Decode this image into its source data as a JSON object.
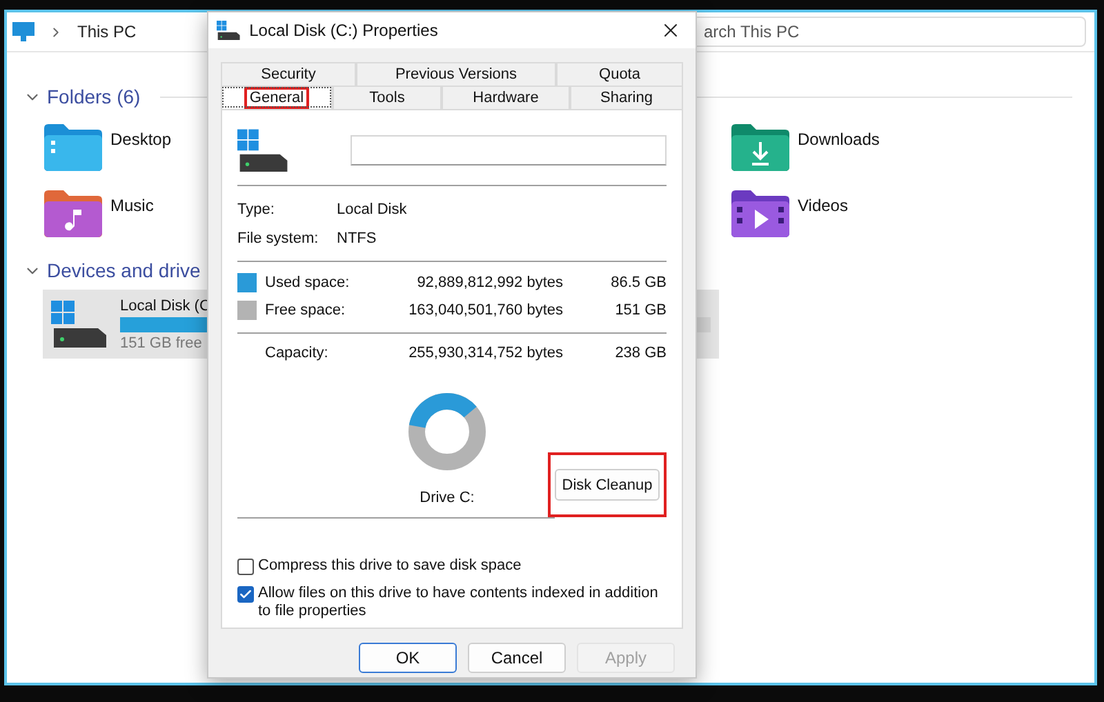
{
  "explorer": {
    "breadcrumb": "This PC",
    "search": {
      "placeholder": "arch This PC"
    },
    "folders_section": {
      "title": "Folders (6)",
      "expanded": true,
      "folders": [
        {
          "name": "Desktop",
          "kind": "desktop"
        },
        {
          "name": "Downloads",
          "kind": "downloads"
        },
        {
          "name": "Music",
          "kind": "music"
        },
        {
          "name": "Videos",
          "kind": "videos"
        }
      ]
    },
    "devices_section": {
      "title": "Devices and drive",
      "expanded": true,
      "drive": {
        "name": "Local Disk (C",
        "free": "151 GB free",
        "level": 0.36,
        "selected": true
      }
    }
  },
  "dialog": {
    "title": "Local Disk (C:) Properties",
    "tab_rows": [
      [
        {
          "label": "Security",
          "selected": false,
          "highlighted": false
        },
        {
          "label": "Previous Versions",
          "selected": false,
          "highlighted": false
        },
        {
          "label": "Quota",
          "selected": false,
          "highlighted": false
        }
      ],
      [
        {
          "label": "General",
          "selected": true,
          "highlighted": true
        },
        {
          "label": "Tools",
          "selected": false,
          "highlighted": false
        },
        {
          "label": "Hardware",
          "selected": false,
          "highlighted": false
        },
        {
          "label": "Sharing",
          "selected": false,
          "highlighted": false
        }
      ]
    ],
    "properties": [
      {
        "label": "Type:",
        "value": "Local Disk"
      },
      {
        "label": "File system:",
        "value": "NTFS"
      }
    ],
    "space": [
      {
        "label": "Used space:",
        "bytes": "92,889,812,992 bytes",
        "size": "86.5 GB",
        "color": "#2a9ad8"
      },
      {
        "label": "Free space:",
        "bytes": "163,040,501,760 bytes",
        "size": "151 GB",
        "color": "#b3b3b3"
      }
    ],
    "capacity": {
      "label": "Capacity:",
      "bytes": "255,930,314,752 bytes",
      "size": "238 GB"
    },
    "usage_ring": {
      "level": 0.36
    },
    "drive_label": "Drive C:",
    "cleanup_button": {
      "label": "Disk Cleanup",
      "highlighted": true
    },
    "options": [
      {
        "label": "Compress this drive to save disk space",
        "checked": false
      },
      {
        "label": "Allow files on this drive to have contents indexed in addition to file properties",
        "checked": true
      }
    ],
    "buttons": [
      {
        "label": "OK",
        "kind": "default"
      },
      {
        "label": "Cancel",
        "kind": "normal"
      },
      {
        "label": "Apply",
        "kind": "disabled"
      }
    ]
  }
}
